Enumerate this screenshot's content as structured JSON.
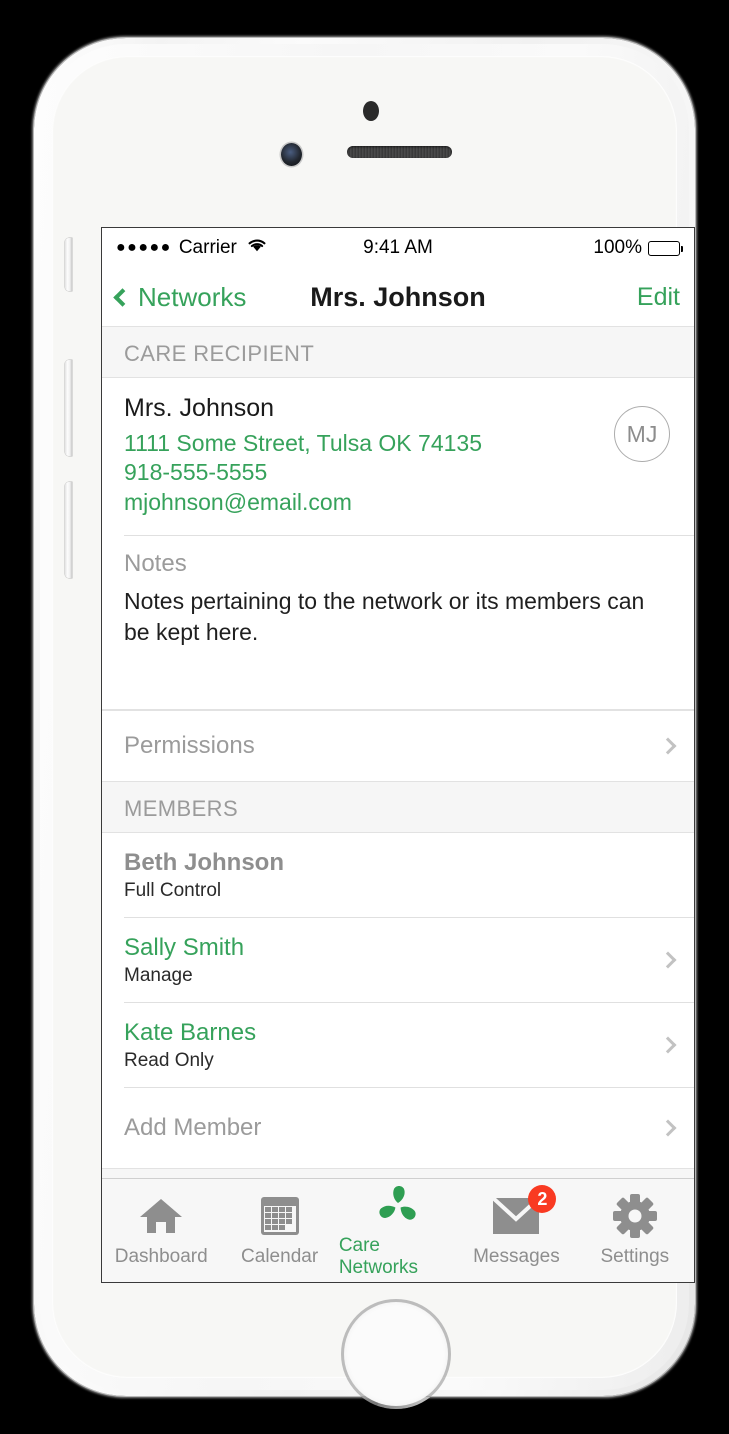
{
  "status_bar": {
    "signal_dots": "●●●●●",
    "carrier": "Carrier",
    "time": "9:41 AM",
    "battery_percent": "100%"
  },
  "nav_bar": {
    "back_label": "Networks",
    "title": "Mrs. Johnson",
    "edit_label": "Edit"
  },
  "care_recipient": {
    "section_title": "CARE RECIPIENT",
    "name": "Mrs. Johnson",
    "address": "1111 Some Street, Tulsa OK 74135",
    "phone": "918-555-5555",
    "email": "mjohnson@email.com",
    "avatar_initials": "MJ"
  },
  "notes": {
    "label": "Notes",
    "body": "Notes pertaining to the network or its members can be kept here."
  },
  "permissions": {
    "label": "Permissions"
  },
  "members": {
    "section_title": "MEMBERS",
    "list": [
      {
        "name": "Beth Johnson",
        "role": "Full Control",
        "style": "gray-bold",
        "chevron": false
      },
      {
        "name": "Sally Smith",
        "role": "Manage",
        "style": "green",
        "chevron": true
      },
      {
        "name": "Kate Barnes",
        "role": "Read Only",
        "style": "green",
        "chevron": true
      }
    ],
    "add_label": "Add Member"
  },
  "tab_bar": {
    "tabs": [
      {
        "label": "Dashboard",
        "icon": "home-icon",
        "active": false,
        "badge": null
      },
      {
        "label": "Calendar",
        "icon": "calendar-icon",
        "active": false,
        "badge": null
      },
      {
        "label": "Care Networks",
        "icon": "care-networks-icon",
        "active": true,
        "badge": null
      },
      {
        "label": "Messages",
        "icon": "envelope-icon",
        "active": false,
        "badge": "2"
      },
      {
        "label": "Settings",
        "icon": "gear-icon",
        "active": false,
        "badge": null
      }
    ]
  },
  "colors": {
    "accent_green": "#36a25b",
    "badge_red": "#f93a22",
    "muted_gray": "#9b9b9b",
    "icon_gray": "#8e8e8e"
  }
}
